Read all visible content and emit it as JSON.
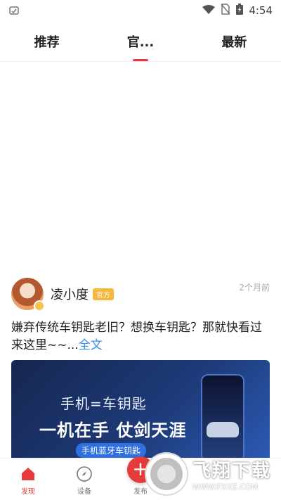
{
  "status_bar": {
    "time": "4:54"
  },
  "tabs": [
    {
      "label": "推荐"
    },
    {
      "label": "官..."
    },
    {
      "label": "最新"
    }
  ],
  "post": {
    "author": "凌小度",
    "tag": "官方",
    "time": "2个月前",
    "text": "嫌弃传统车钥匙老旧？想换车钥匙？那就快看过来这里~~...",
    "full_text_label": "全文",
    "image": {
      "line1": "手机=车钥匙",
      "line2": "一机在手 仗剑天涯",
      "pill": "手机蓝牙车钥匙"
    }
  },
  "bottom_nav": [
    {
      "label": "发现",
      "icon": "home-icon"
    },
    {
      "label": "设备",
      "icon": "compass-icon"
    },
    {
      "label": "发布",
      "icon": "plus-icon"
    }
  ],
  "watermark": {
    "title": "飞翔下载",
    "url": "WWW.FXXZ.COM"
  },
  "colors": {
    "accent": "#e53b3b",
    "link": "#3a8ee6"
  }
}
